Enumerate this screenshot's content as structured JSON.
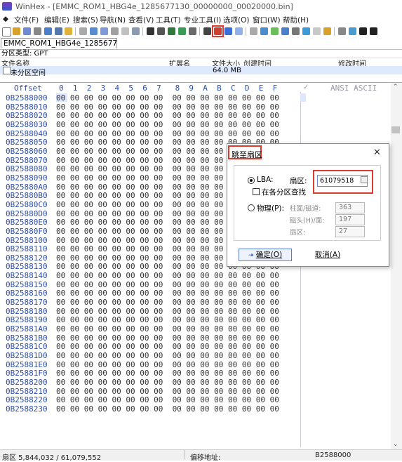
{
  "window": {
    "title": "WinHex - [EMMC_ROM1_HBG4e_1285677130_00000000_00020000.bin]"
  },
  "menu": [
    {
      "label": "文件(F)"
    },
    {
      "label": "编辑(E)"
    },
    {
      "label": "搜索(S)"
    },
    {
      "label": "导航(N)"
    },
    {
      "label": "查看(V)"
    },
    {
      "label": "工具(T)"
    },
    {
      "label": "专业工具(I)"
    },
    {
      "label": "选项(O)"
    },
    {
      "label": "窗口(W)"
    },
    {
      "label": "帮助(H)"
    }
  ],
  "tab": {
    "label": "EMMC_ROM1_HBG4e_12856771..."
  },
  "partition_type": "分区类型: GPT",
  "file_list": {
    "headers": {
      "name": "文件名称",
      "ext": "扩展名",
      "size": "文件大小",
      "created": "创建时间",
      "modified": "修改时间"
    },
    "rows": [
      {
        "name": "未分区空间",
        "size": "64.0 MB"
      }
    ]
  },
  "hex_view": {
    "offset_header": "Offset",
    "column_header": "0  1  2  3  4  5  6  7   8  9  A  B  C  D  E  F",
    "ascii_header": "ANSI ASCII",
    "offsets": [
      "0B2588000",
      "0B2588010",
      "0B2588020",
      "0B2588030",
      "0B2588040",
      "0B2588050",
      "0B2588060",
      "0B2588070",
      "0B2588080",
      "0B2588090",
      "0B25880A0",
      "0B25880B0",
      "0B25880C0",
      "0B25880D0",
      "0B25880E0",
      "0B25880F0",
      "0B2588100",
      "0B2588110",
      "0B2588120",
      "0B2588130",
      "0B2588140",
      "0B2588150",
      "0B2588160",
      "0B2588170",
      "0B2588180",
      "0B2588190",
      "0B25881A0",
      "0B25881B0",
      "0B25881C0",
      "0B25881D0",
      "0B25881E0",
      "0B25881F0",
      "0B2588200",
      "0B2588210",
      "0B2588220",
      "0B2588230"
    ],
    "row_bytes": "00 00 00 00 00 00 00 00  00 00 00 00 00 00 00 00"
  },
  "dialog": {
    "title": "跳至扇区",
    "close_glyph": "✕",
    "lba_label": "LBA:",
    "sector_label": "扇区:",
    "sector_value": "61079518",
    "search_each_partition": "在各分区查找",
    "physical_label": "物理(P):",
    "cylinder_label": "柱面/磁道:",
    "cylinder_value": "363",
    "head_label": "磁头(H)/面:",
    "head_value": "197",
    "sector2_label": "扇区:",
    "sector2_value": "27",
    "ok_label": "确定(O)",
    "cancel_label": "取消(A)"
  },
  "status": {
    "sector": "扇区 5,844,032 / 61,079,552",
    "offset_label": "偏移地址:",
    "offset_value": "B2588000"
  },
  "accent_colors": {
    "highlight": "#e03a2e",
    "offset_blue": "#2d4fb0"
  }
}
